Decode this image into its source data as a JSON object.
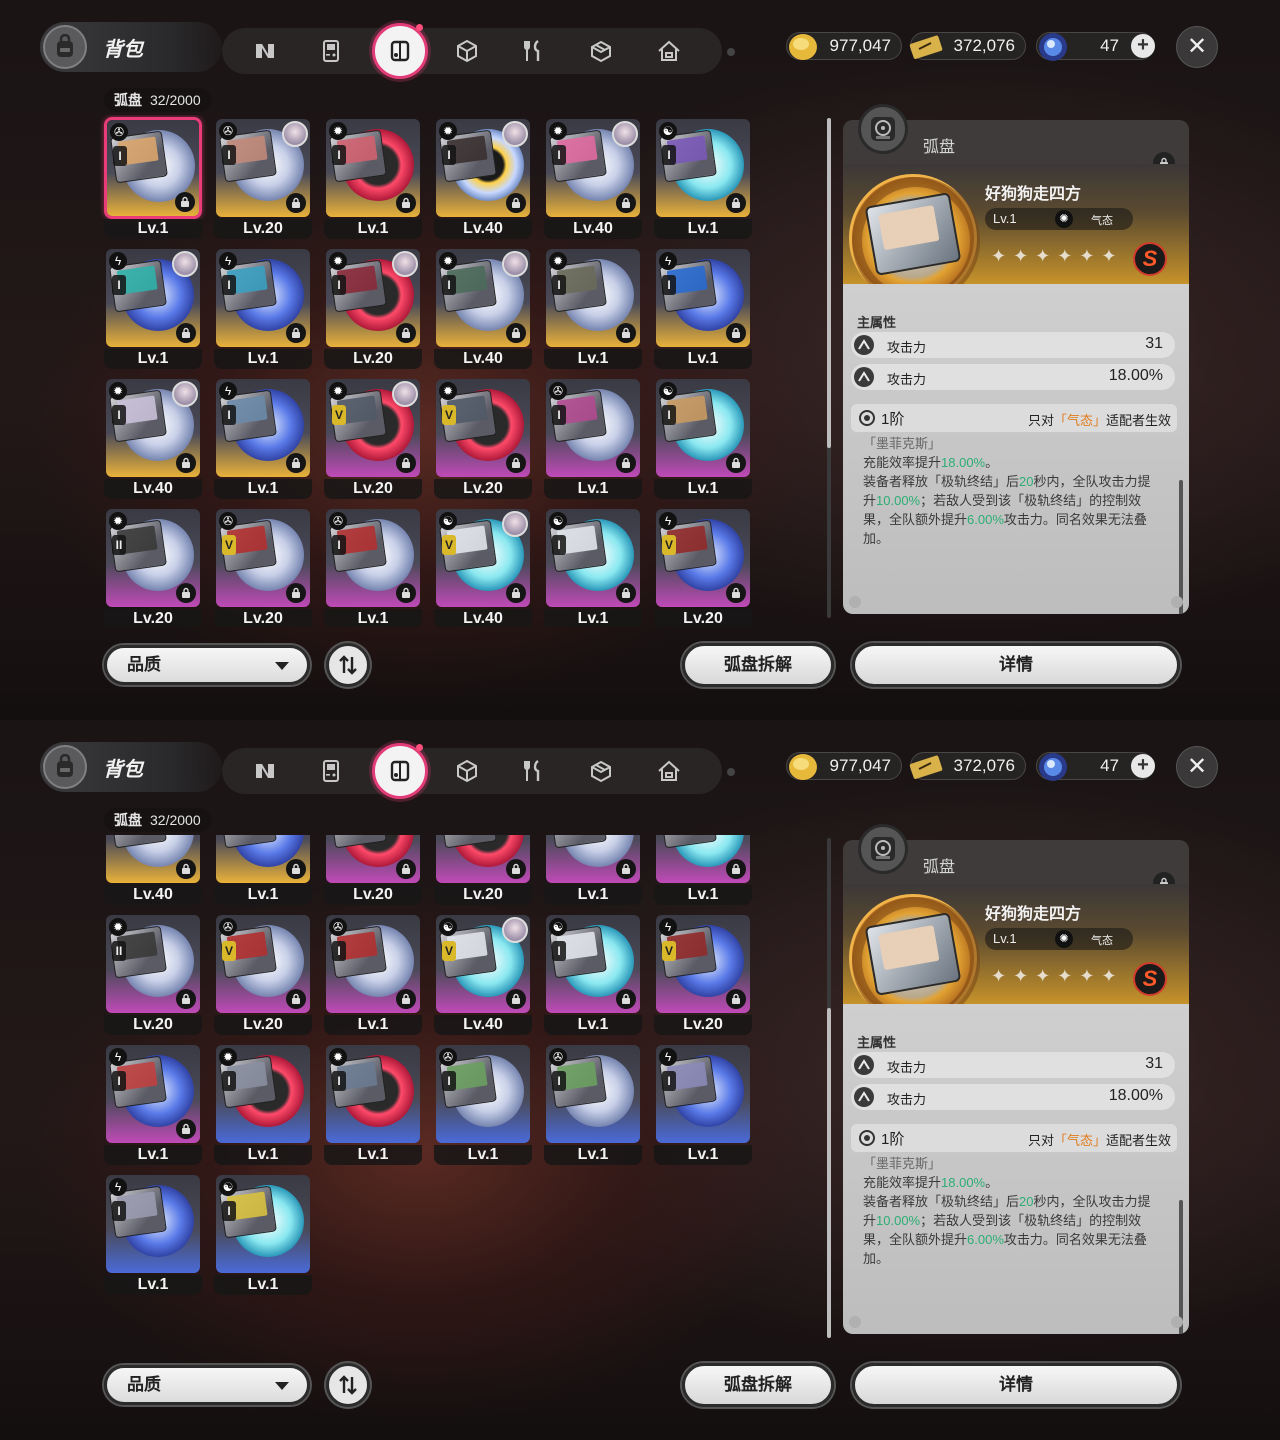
{
  "header": {
    "title": "背包",
    "categories": [
      {
        "icon": "n-logo-icon"
      },
      {
        "icon": "gameboy-icon"
      },
      {
        "icon": "disc-icon",
        "active": true
      },
      {
        "icon": "cube-icon"
      },
      {
        "icon": "fork-knife-icon"
      },
      {
        "icon": "box-icon"
      },
      {
        "icon": "house-icon"
      }
    ]
  },
  "currencies": {
    "coins": "977,047",
    "tickets": "372,076",
    "stamina": "47"
  },
  "inventory": {
    "category_name": "弧盘",
    "count": "32/2000"
  },
  "controls": {
    "sort_label": "品质",
    "dismantle_label": "弧盘拆解",
    "details_label": "详情"
  },
  "details": {
    "type_label": "弧盘",
    "name": "好狗狗走四方",
    "level": "Lv.1",
    "faction": "气态",
    "stars": "✦✦✦✦✦✦",
    "rarity": "S",
    "main_stat_title": "主属性",
    "stats": [
      {
        "name": "攻击力",
        "value": "31"
      },
      {
        "name": "攻击力",
        "value": "18.00%"
      }
    ],
    "tier": "1阶",
    "restriction_pre": "只对",
    "restriction_hl": "「气态」",
    "restriction_post": "适配者生效",
    "effect_quote": "「墨菲克斯」",
    "effect_lines": [
      [
        "充能效率提升",
        "18.00%",
        "。"
      ],
      [
        "装备者释放「极轨终结」后",
        "20",
        "秒内，全队攻击力提"
      ],
      [
        "升",
        "10.00%",
        "；若敌人受到该「极轨终结」的控制效"
      ],
      [
        "果，全队额外提升",
        "6.00%",
        "攻击力。同名效果无法叠"
      ],
      [
        "加。",
        "",
        ""
      ]
    ]
  },
  "screen1_cards": [
    {
      "lv": "Lv.1",
      "q": "gold",
      "f": "spin",
      "r": "I",
      "avatar": false,
      "lock": true,
      "sel": true,
      "disc": "white",
      "art": "#d9a46b"
    },
    {
      "lv": "Lv.20",
      "q": "gold",
      "f": "spin",
      "r": "I",
      "avatar": true,
      "lock": true,
      "disc": "white",
      "art": "#c08a7a"
    },
    {
      "lv": "Lv.1",
      "q": "gold",
      "f": "gear",
      "r": "I",
      "avatar": false,
      "lock": true,
      "disc": "red",
      "art": "#d06070"
    },
    {
      "lv": "Lv.40",
      "q": "gold",
      "f": "gear",
      "r": "I",
      "avatar": true,
      "lock": true,
      "disc": "sun",
      "art": "#3a3030"
    },
    {
      "lv": "Lv.40",
      "q": "gold",
      "f": "gear",
      "r": "I",
      "avatar": true,
      "lock": true,
      "disc": "white",
      "art": "#e06aa0"
    },
    {
      "lv": "Lv.1",
      "q": "gold",
      "f": "swirl",
      "r": "I",
      "avatar": false,
      "lock": true,
      "disc": "cyan",
      "art": "#7a5ab8"
    },
    {
      "lv": "Lv.1",
      "q": "gold",
      "f": "bolt",
      "r": "I",
      "avatar": true,
      "lock": true,
      "disc": "blue",
      "art": "#30b0a8"
    },
    {
      "lv": "Lv.1",
      "q": "gold",
      "f": "bolt",
      "r": "I",
      "avatar": false,
      "lock": true,
      "disc": "blue",
      "art": "#3aa0c0"
    },
    {
      "lv": "Lv.20",
      "q": "gold",
      "f": "gear",
      "r": "I",
      "avatar": true,
      "lock": true,
      "disc": "red",
      "art": "#8a2a3a"
    },
    {
      "lv": "Lv.40",
      "q": "gold",
      "f": "gear",
      "r": "I",
      "avatar": true,
      "lock": true,
      "disc": "white",
      "art": "#4a6a5a"
    },
    {
      "lv": "Lv.1",
      "q": "gold",
      "f": "gear",
      "r": "I",
      "avatar": false,
      "lock": true,
      "disc": "white",
      "art": "#6a6a5a"
    },
    {
      "lv": "Lv.1",
      "q": "gold",
      "f": "bolt",
      "r": "I",
      "avatar": false,
      "lock": true,
      "disc": "blue",
      "art": "#2a6ad0"
    },
    {
      "lv": "Lv.40",
      "q": "gold",
      "f": "gear",
      "r": "I",
      "avatar": true,
      "lock": true,
      "disc": "white",
      "art": "#c8c0d8"
    },
    {
      "lv": "Lv.1",
      "q": "gold",
      "f": "bolt",
      "r": "I",
      "avatar": false,
      "lock": true,
      "disc": "blue",
      "art": "#6a8aa8"
    },
    {
      "lv": "Lv.20",
      "q": "purple",
      "f": "gear",
      "r": "V",
      "avatar": true,
      "lock": true,
      "disc": "red",
      "art": "#505a66"
    },
    {
      "lv": "Lv.20",
      "q": "purple",
      "f": "gear",
      "r": "V",
      "avatar": false,
      "lock": true,
      "disc": "red",
      "art": "#505a66"
    },
    {
      "lv": "Lv.1",
      "q": "purple",
      "f": "spin",
      "r": "I",
      "avatar": false,
      "lock": true,
      "disc": "white",
      "art": "#b04a90"
    },
    {
      "lv": "Lv.1",
      "q": "purple",
      "f": "swirl",
      "r": "I",
      "avatar": false,
      "lock": true,
      "disc": "cyan",
      "art": "#c89a60"
    },
    {
      "lv": "Lv.20",
      "q": "purple",
      "f": "gear",
      "r": "II",
      "avatar": false,
      "lock": true,
      "disc": "white",
      "art": "#3a3a3a"
    },
    {
      "lv": "Lv.20",
      "q": "purple",
      "f": "spin",
      "r": "V",
      "avatar": false,
      "lock": true,
      "disc": "white",
      "art": "#b03030"
    },
    {
      "lv": "Lv.1",
      "q": "purple",
      "f": "spin",
      "r": "I",
      "avatar": false,
      "lock": true,
      "disc": "white",
      "art": "#b03030"
    },
    {
      "lv": "Lv.40",
      "q": "purple",
      "f": "swirl",
      "r": "V",
      "avatar": true,
      "lock": true,
      "disc": "cyan",
      "art": "#e0e4ea"
    },
    {
      "lv": "Lv.1",
      "q": "purple",
      "f": "swirl",
      "r": "I",
      "avatar": false,
      "lock": true,
      "disc": "cyan",
      "art": "#e0e4ea"
    },
    {
      "lv": "Lv.20",
      "q": "purple",
      "f": "bolt",
      "r": "V",
      "avatar": false,
      "lock": true,
      "disc": "blue",
      "art": "#902a2a"
    }
  ],
  "screen2_cards": [
    {
      "lv": "Lv.40",
      "q": "gold",
      "f": "gear",
      "r": "I",
      "avatar": true,
      "lock": true,
      "disc": "white",
      "art": "#c8c0d8"
    },
    {
      "lv": "Lv.1",
      "q": "gold",
      "f": "bolt",
      "r": "I",
      "avatar": false,
      "lock": true,
      "disc": "blue",
      "art": "#6a8aa8"
    },
    {
      "lv": "Lv.20",
      "q": "purple",
      "f": "gear",
      "r": "V",
      "avatar": true,
      "lock": true,
      "disc": "red",
      "art": "#505a66"
    },
    {
      "lv": "Lv.20",
      "q": "purple",
      "f": "gear",
      "r": "V",
      "avatar": false,
      "lock": true,
      "disc": "red",
      "art": "#505a66"
    },
    {
      "lv": "Lv.1",
      "q": "purple",
      "f": "spin",
      "r": "I",
      "avatar": false,
      "lock": true,
      "disc": "white",
      "art": "#b04a90"
    },
    {
      "lv": "Lv.1",
      "q": "purple",
      "f": "swirl",
      "r": "I",
      "avatar": false,
      "lock": true,
      "disc": "cyan",
      "art": "#c89a60"
    },
    {
      "lv": "Lv.20",
      "q": "purple",
      "f": "gear",
      "r": "II",
      "avatar": false,
      "lock": true,
      "disc": "white",
      "art": "#3a3a3a"
    },
    {
      "lv": "Lv.20",
      "q": "purple",
      "f": "spin",
      "r": "V",
      "avatar": false,
      "lock": true,
      "disc": "white",
      "art": "#b03030"
    },
    {
      "lv": "Lv.1",
      "q": "purple",
      "f": "spin",
      "r": "I",
      "avatar": false,
      "lock": true,
      "disc": "white",
      "art": "#b03030"
    },
    {
      "lv": "Lv.40",
      "q": "purple",
      "f": "swirl",
      "r": "V",
      "avatar": true,
      "lock": true,
      "disc": "cyan",
      "art": "#e0e4ea"
    },
    {
      "lv": "Lv.1",
      "q": "purple",
      "f": "swirl",
      "r": "I",
      "avatar": false,
      "lock": true,
      "disc": "cyan",
      "art": "#e0e4ea"
    },
    {
      "lv": "Lv.20",
      "q": "purple",
      "f": "bolt",
      "r": "V",
      "avatar": false,
      "lock": true,
      "disc": "blue",
      "art": "#902a2a"
    },
    {
      "lv": "Lv.1",
      "q": "purple",
      "f": "bolt",
      "r": "I",
      "avatar": false,
      "lock": true,
      "disc": "blue",
      "art": "#c04040"
    },
    {
      "lv": "Lv.1",
      "q": "blue",
      "f": "gear",
      "r": "I",
      "avatar": false,
      "lock": false,
      "disc": "red",
      "art": "#8a8fa0"
    },
    {
      "lv": "Lv.1",
      "q": "blue",
      "f": "gear",
      "r": "I",
      "avatar": false,
      "lock": false,
      "disc": "red",
      "art": "#6a7a90"
    },
    {
      "lv": "Lv.1",
      "q": "blue",
      "f": "spin",
      "r": "I",
      "avatar": false,
      "lock": false,
      "disc": "white",
      "art": "#6aa060"
    },
    {
      "lv": "Lv.1",
      "q": "blue",
      "f": "spin",
      "r": "I",
      "avatar": false,
      "lock": false,
      "disc": "white",
      "art": "#6aa060"
    },
    {
      "lv": "Lv.1",
      "q": "blue",
      "f": "bolt",
      "r": "I",
      "avatar": false,
      "lock": false,
      "disc": "blue",
      "art": "#8a8ab8"
    },
    {
      "lv": "Lv.1",
      "q": "blue",
      "f": "bolt",
      "r": "I",
      "avatar": false,
      "lock": false,
      "disc": "blue",
      "art": "#9a9ab0"
    },
    {
      "lv": "Lv.1",
      "q": "blue",
      "f": "swirl",
      "r": "I",
      "avatar": false,
      "lock": false,
      "disc": "cyan",
      "art": "#d8c040"
    }
  ],
  "colors": {
    "gold": "#e9b23a",
    "purple": "#c04ab8",
    "blue": "#4a6ad8",
    "accent_pink": "#e23c78",
    "stat_green": "#2cae74",
    "restriction_orange": "#e07a1a"
  }
}
